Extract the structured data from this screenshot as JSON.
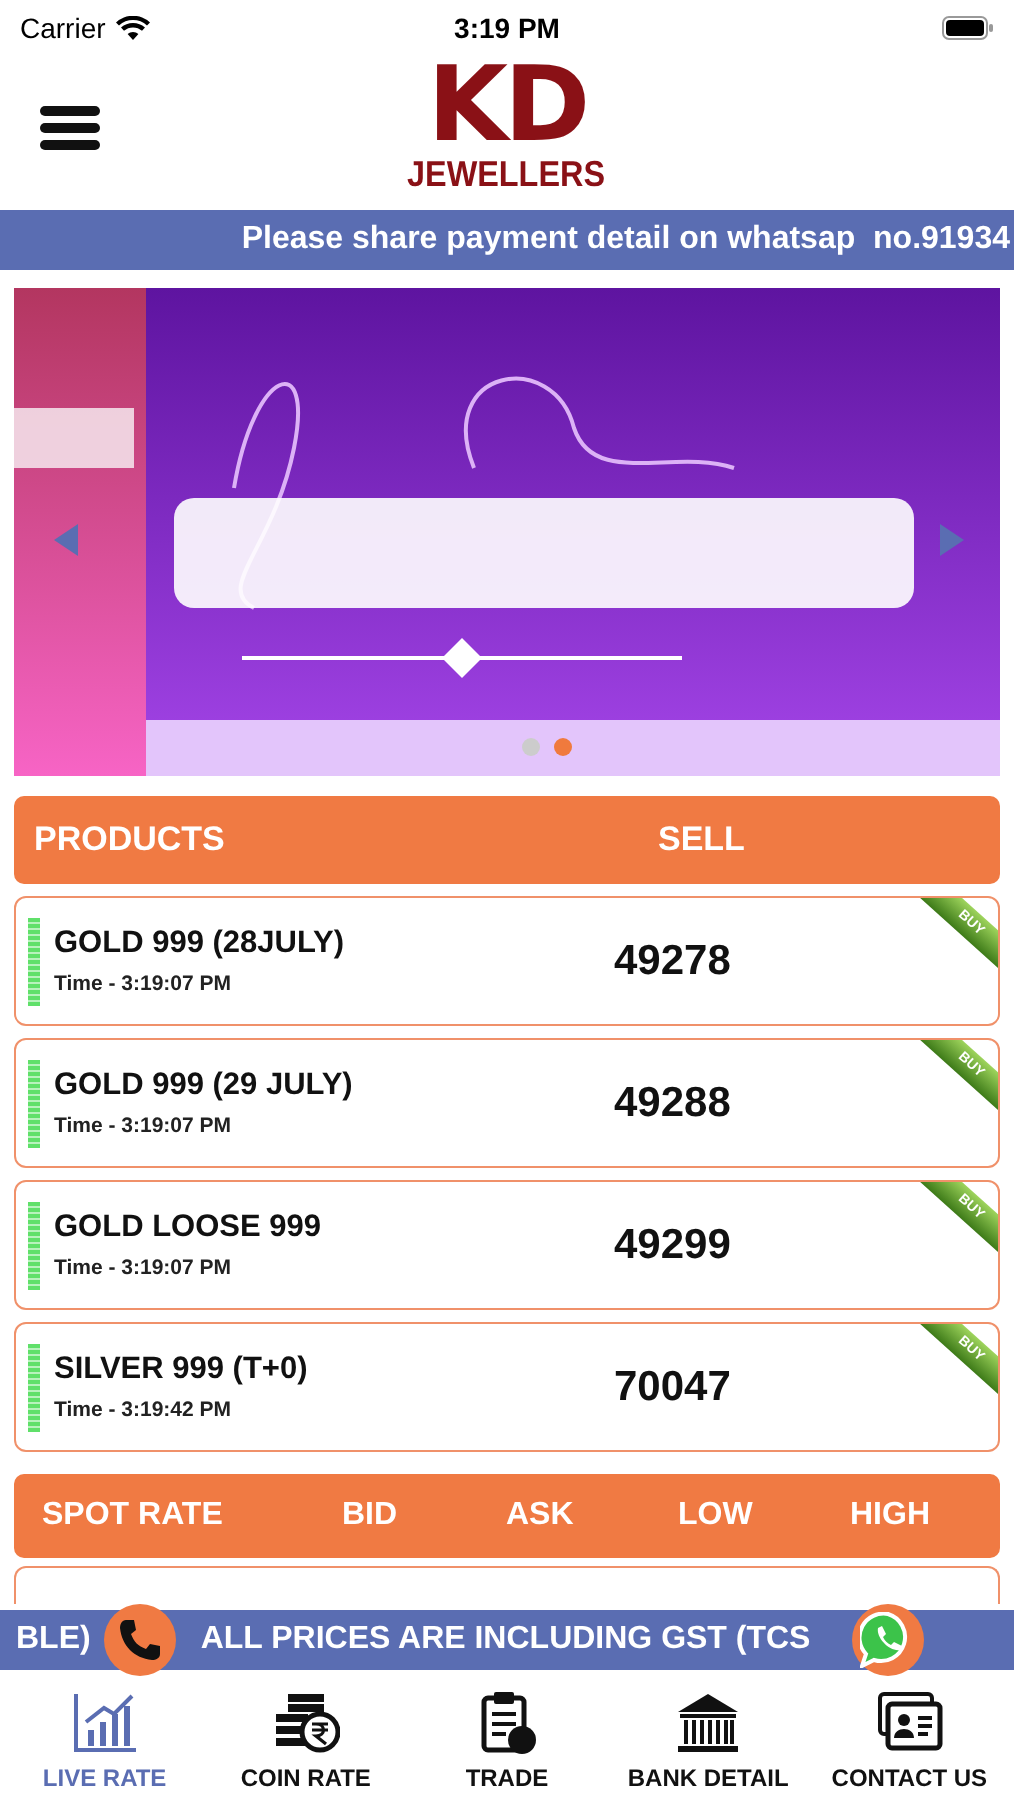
{
  "status_bar": {
    "carrier": "Carrier",
    "time": "3:19 PM"
  },
  "header": {
    "logo_mark": "KD",
    "logo_text": "JEWELLERS"
  },
  "ticker_top": "Please share payment detail on whatsap  no.91934",
  "banner": {
    "kind": "picture",
    "dots": [
      {
        "selected": false
      },
      {
        "selected": true
      }
    ]
  },
  "products": {
    "columns": [
      "PRODUCTS",
      "SELL"
    ],
    "rows": [
      {
        "name": "GOLD 999 (28JULY)",
        "time": "Time - 3:19:07 PM",
        "sell": "49278",
        "badge": "BUY"
      },
      {
        "name": "GOLD 999 (29 JULY)",
        "time": "Time - 3:19:07 PM",
        "sell": "49288",
        "badge": "BUY"
      },
      {
        "name": "GOLD LOOSE 999",
        "time": "Time - 3:19:07 PM",
        "sell": "49299",
        "badge": "BUY"
      },
      {
        "name": "SILVER 999 (T+0)",
        "time": "Time - 3:19:42 PM",
        "sell": "70047",
        "badge": "BUY"
      }
    ]
  },
  "spot_rate": {
    "columns": [
      "SPOT RATE",
      "BID",
      "ASK",
      "LOW",
      "HIGH"
    ]
  },
  "ticker_bottom": "BLE)",
  "ticker_bottom_2": "ALL PRICES ARE INCLUDING GST (TCS",
  "tabs": [
    {
      "label": "LIVE RATE",
      "kind": "chart",
      "selected": true
    },
    {
      "label": "COIN RATE",
      "kind": "coins",
      "selected": false
    },
    {
      "label": "TRADE",
      "kind": "clipboard",
      "selected": false
    },
    {
      "label": "BANK DETAIL",
      "kind": "bank",
      "selected": false
    },
    {
      "label": "CONTACT US",
      "kind": "contact",
      "selected": false
    }
  ]
}
